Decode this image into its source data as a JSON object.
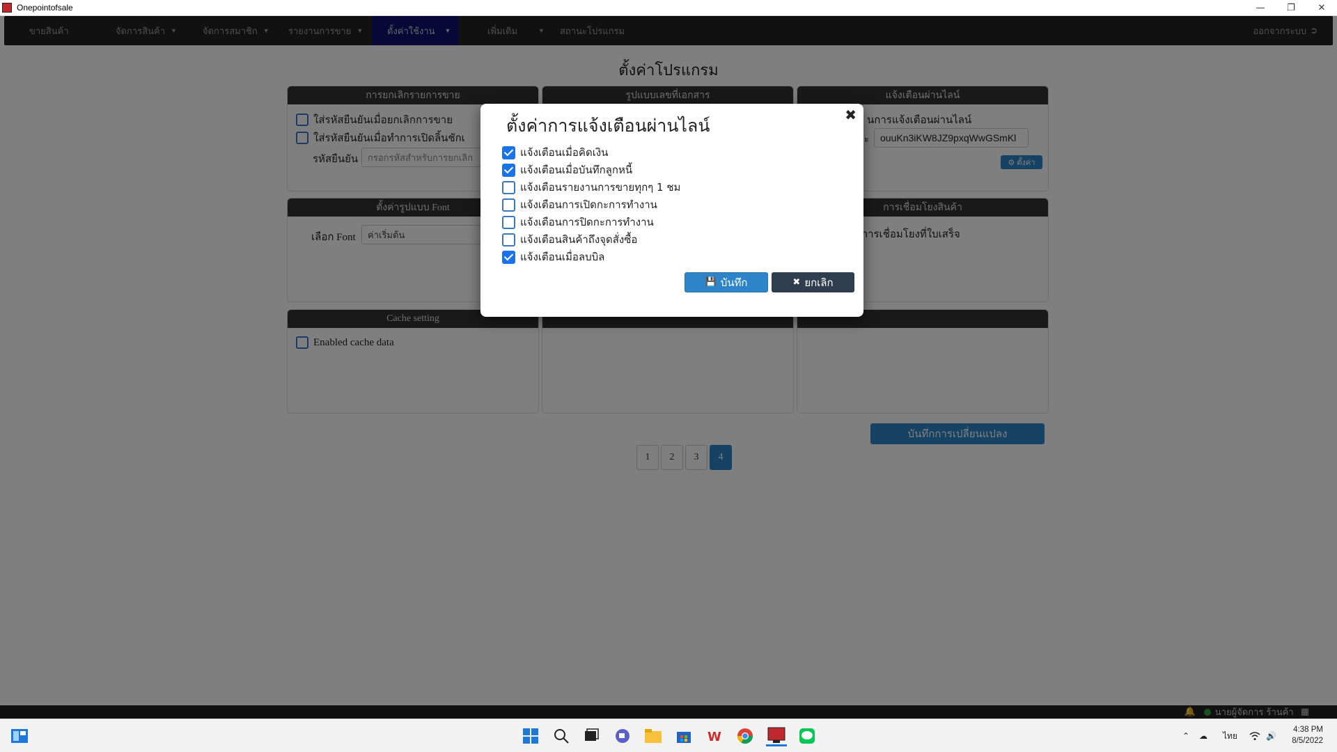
{
  "window": {
    "title": "Onepointofsale"
  },
  "navbar": {
    "items": [
      {
        "label": "ขายสินค้า",
        "has_caret": false
      },
      {
        "label": "จัดการสินค้า",
        "has_caret": true
      },
      {
        "label": "จัดการสมาชิก",
        "has_caret": true
      },
      {
        "label": "รายงานการขาย",
        "has_caret": true
      },
      {
        "label": "ตั้งค่าใช้งาน",
        "has_caret": true
      },
      {
        "label": "เพิ่มเติม",
        "has_caret": true
      },
      {
        "label": "สถานะโปรแกรม",
        "has_caret": false
      }
    ],
    "logout": "ออกจากระบบ"
  },
  "page": {
    "title": "ตั้งค่าโปรแกรม",
    "panels": {
      "cancel_sale": {
        "heading": "การยกเลิกรายการขาย",
        "opt1": "ใส่รหัสยืนยันเมื่อยกเลิกการขาย",
        "opt2": "ใส่รหัสยืนยันเมื่อทำการเปิดลิ้นชักเ",
        "code_label": "รหัสยืนยัน",
        "code_placeholder": "กรอกรหัสสำหรับการยกเลิก"
      },
      "doc_number": {
        "heading": "รูปแบบเลขที่เอกสาร"
      },
      "line_notify": {
        "heading": "แจ้งเตือนผ่านไลน์",
        "text": "นการแจ้งเตือนผ่านไลน์",
        "token_prefix": "ะ",
        "token": "ouuKn3iKW8JZ9pxqWwGSmKl",
        "settings_button": "ตั้งค่า"
      },
      "font": {
        "heading": "ตั้งค่ารูปแบบ Font",
        "label": "เลือก Font",
        "value": "ค่าเริ่มต้น"
      },
      "product_link": {
        "heading": "การเชื่อมโยงสินค้า",
        "text": "การเชื่อมโยงที่ใบเสร็จ"
      },
      "cache": {
        "heading": "Cache setting",
        "option": "Enabled cache data"
      }
    },
    "save_changes": "บันทึกการเปลี่ยนแปลง",
    "pages": [
      "1",
      "2",
      "3",
      "4"
    ],
    "active_page": "4"
  },
  "status_bar": {
    "user": "นายผู้จัดการ ร้านค้า"
  },
  "modal": {
    "title": "ตั้งค่าการแจ้งเตือนผ่านไลน์",
    "options": [
      {
        "label": "แจ้งเตือนเมื่อคิดเงิน",
        "checked": true
      },
      {
        "label": "แจ้งเตือนเมื่อบันทึกลูกหนี้",
        "checked": true
      },
      {
        "label": "แจ้งเตือนรายงานการขายทุกๆ 1 ชม",
        "checked": false
      },
      {
        "label": "แจ้งเตือนการเปิดกะการทำงาน",
        "checked": false
      },
      {
        "label": "แจ้งเตือนการปิดกะการทำงาน",
        "checked": false
      },
      {
        "label": "แจ้งเตือนสินค้าถึงจุดสั่งซื้อ",
        "checked": false
      },
      {
        "label": "แจ้งเตือนเมื่อลบบิล",
        "checked": true
      }
    ],
    "save": "บันทึก",
    "cancel": "ยกเลิก"
  },
  "taskbar": {
    "language": "ไทย",
    "time": "4:38 PM",
    "date": "8/5/2022"
  },
  "colors": {
    "accent": "#2d84c9",
    "navbar": "#222222",
    "cancel_button": "#2f3e4e",
    "checkbox_checked": "#1a73e8"
  }
}
